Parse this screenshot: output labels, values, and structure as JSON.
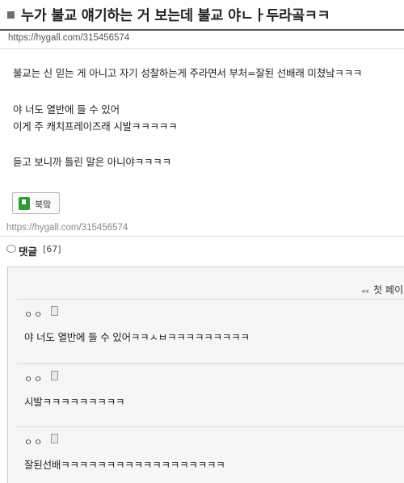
{
  "post": {
    "title": "누가 불교 얘기하는 거 보는데 불교 야ㄴㅏ두라곸ㅋㅋ",
    "url": "https://hygall.com/315456574",
    "body_lines": [
      "불교는 신 믿는 게 아니고 자기 성찰하는게 주라면서 부처=잘된 선배래 미쳤낰ㅋㅋㅋ",
      "야 너도 열반에 들 수 있어",
      "이게 주 캐치프레이즈래 시발ㅋㅋㅋㅋㅋ",
      "듣고 보니까 틀린 말은 아니야ㅋㅋㅋㅋ"
    ],
    "bookmark_label": "북맠",
    "url_bottom": "https://hygall.com/315456574"
  },
  "comments": {
    "title": "댓글",
    "count": "[67]",
    "pager_label": "첫 페이",
    "items": [
      {
        "author": "ㅇㅇ",
        "text": "야 너도 열반에 들 수 있어ㅋㅋㅅㅂㅋㅋㅋㅋㅋㅋㅋㅋㅋ"
      },
      {
        "author": "ㅇㅇ",
        "text": "시발ㅋㅋㅋㅋㅋㅋㅋㅋㅋ"
      },
      {
        "author": "ㅇㅇ",
        "text": "잘된선배ㅋㅋㅋㅋㅋㅋㅋㅋㅋㅋㅋㅋㅋㅋㅋㅋㅋㅋ"
      }
    ]
  },
  "colors": {
    "bookmark_icon": "#2f9b37",
    "title_rule": "#555555",
    "comment_bg": "#f6f6f6"
  },
  "icons": [
    "title-bullet-icon",
    "bookmark-icon",
    "speech-bubble-icon",
    "document-icon",
    "double-left-arrow-icon"
  ]
}
